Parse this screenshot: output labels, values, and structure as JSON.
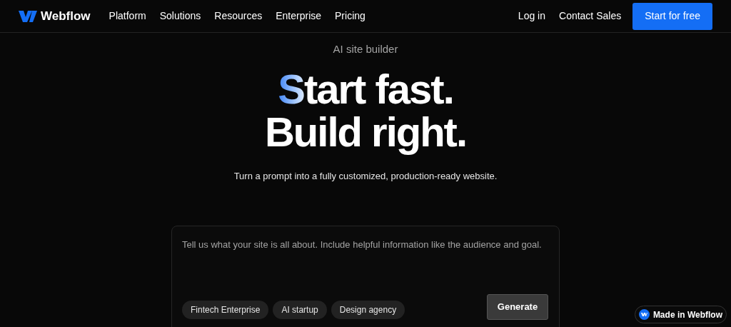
{
  "nav": {
    "brand": "Webflow",
    "links": [
      "Platform",
      "Solutions",
      "Resources",
      "Enterprise",
      "Pricing"
    ],
    "login": "Log in",
    "contact": "Contact Sales",
    "cta": "Start for free"
  },
  "hero": {
    "eyebrow": "AI site builder",
    "headline": [
      {
        "accent": "S",
        "text": "tart fast."
      },
      {
        "text": "Build right."
      }
    ],
    "subtitle": "Turn a prompt into a fully customized, production-ready website."
  },
  "prompt": {
    "placeholder": "Tell us what your site is all about. Include helpful information like the audience and goal.",
    "chips": [
      "Fintech Enterprise",
      "AI startup",
      "Design agency"
    ],
    "button": "Generate"
  },
  "badge": "Made in Webflow"
}
